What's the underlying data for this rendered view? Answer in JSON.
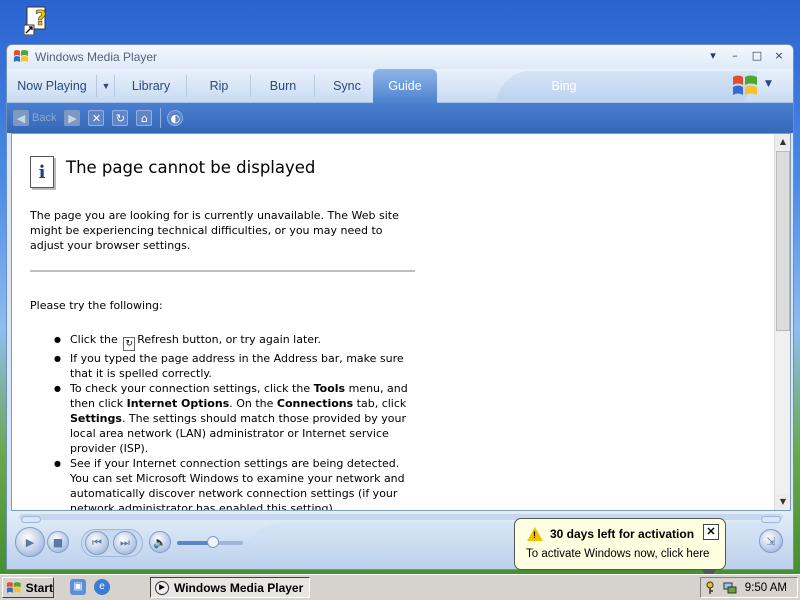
{
  "desktop": {
    "icons": [
      "help-shortcut-icon"
    ]
  },
  "window": {
    "title": "Windows Media Player",
    "controls": {
      "menu": "▾",
      "minimize": "–",
      "maximize": "□",
      "close": "×"
    }
  },
  "tabs": [
    {
      "label": "Now Playing"
    },
    {
      "label": "Library"
    },
    {
      "label": "Rip"
    },
    {
      "label": "Burn"
    },
    {
      "label": "Sync"
    },
    {
      "label": "Guide",
      "active": true
    },
    {
      "label": "Bing"
    }
  ],
  "toolbar": {
    "back_label": "Back"
  },
  "page": {
    "title": "The page cannot be displayed",
    "intro": "The page you are looking for is currently unavailable. The Web site might be experiencing technical difficulties, or you may need to adjust your browser settings.",
    "try_heading": "Please try the following:",
    "items": [
      {
        "segments": [
          "Click the ",
          "Refresh button, or try again later."
        ]
      },
      {
        "text": "If you typed the page address in the Address bar, make sure that it is spelled correctly."
      },
      {
        "segments": [
          "To check your connection settings, click the ",
          "Tools",
          " menu, and then click ",
          "Internet Options",
          ". On the ",
          "Connections",
          " tab, click ",
          "Settings",
          ". The settings should match those provided by your local area network (LAN) administrator or Internet service provider (ISP)."
        ]
      },
      {
        "text": "See if your Internet connection settings are being detected. You can set Microsoft Windows to examine your network and automatically discover network connection settings (if your network administrator has enabled this setting)."
      }
    ]
  },
  "player": {
    "volume": 0.55
  },
  "balloon": {
    "title": "30 days left for activation",
    "text": "To activate Windows now, click here"
  },
  "taskbar": {
    "start_label": "Start",
    "task_label": "Windows Media Player",
    "clock": "9:50 AM"
  },
  "colors": {
    "accent": "#3567b8",
    "tab_active": "#4b83d0",
    "balloon_bg": "#ffffe1",
    "taskbar_bg": "#d6d3ce"
  }
}
